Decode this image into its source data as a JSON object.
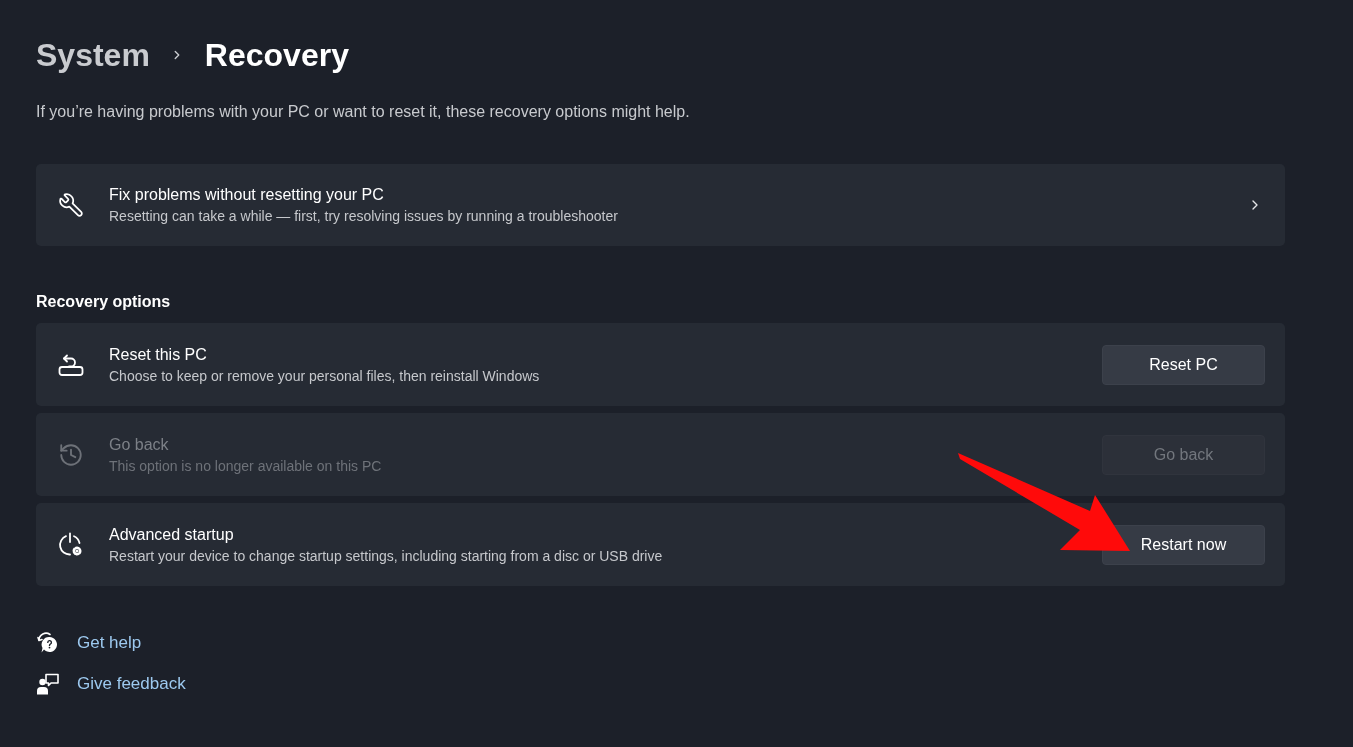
{
  "breadcrumb": {
    "parent": "System",
    "current": "Recovery"
  },
  "description": "If you’re having problems with your PC or want to reset it, these recovery options might help.",
  "fix_card": {
    "title": "Fix problems without resetting your PC",
    "subtitle": "Resetting can take a while — first, try resolving issues by running a troubleshooter"
  },
  "section_title": "Recovery options",
  "options": [
    {
      "kind": "reset",
      "title": "Reset this PC",
      "subtitle": "Choose to keep or remove your personal files, then reinstall Windows",
      "button": "Reset PC",
      "disabled": false
    },
    {
      "kind": "goback",
      "title": "Go back",
      "subtitle": "This option is no longer available on this PC",
      "button": "Go back",
      "disabled": true
    },
    {
      "kind": "startup",
      "title": "Advanced startup",
      "subtitle": "Restart your device to change startup settings, including starting from a disc or USB drive",
      "button": "Restart now",
      "disabled": false
    }
  ],
  "links": [
    {
      "kind": "help",
      "label": "Get help"
    },
    {
      "kind": "feedback",
      "label": "Give feedback"
    }
  ]
}
